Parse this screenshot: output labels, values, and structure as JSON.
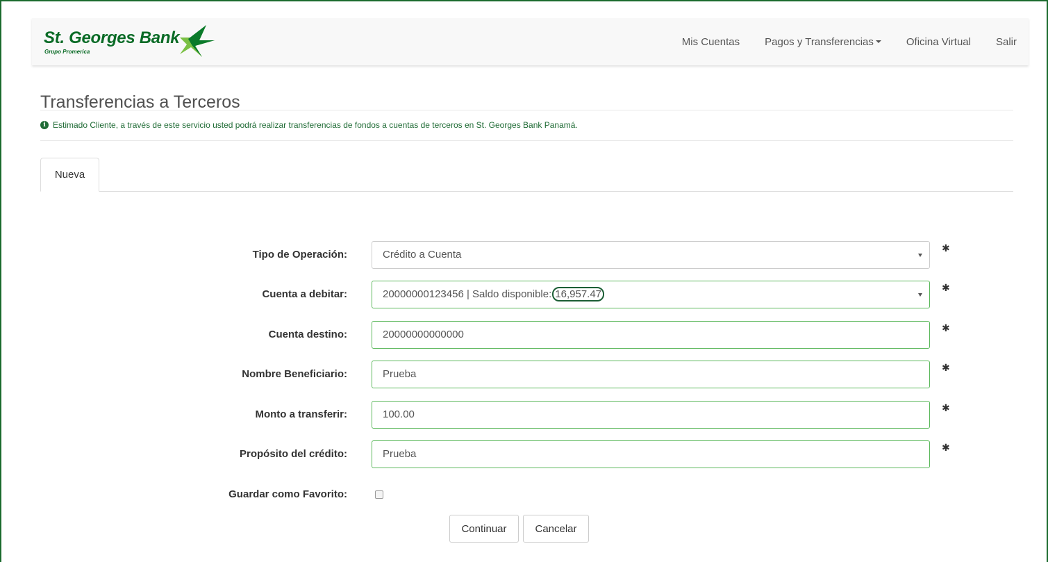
{
  "brand": {
    "name": "St. Georges Bank",
    "subtitle": "Grupo Promerica",
    "star_color": "#0a8a2a"
  },
  "nav": {
    "items": [
      "Mis Cuentas",
      "Pagos y Transferencias",
      "Oficina Virtual",
      "Salir"
    ]
  },
  "page": {
    "title": "Transferencias a Terceros",
    "info": "Estimado Cliente, a través de este servicio usted podrá realizar transferencias de fondos a cuentas de terceros en St. Georges Bank Panamá."
  },
  "tabs": [
    "Nueva"
  ],
  "form": {
    "tipo_operacion": {
      "label": "Tipo de Operación:",
      "value": "Crédito a Cuenta"
    },
    "cuenta_debitar": {
      "label": "Cuenta a debitar:",
      "value": "20000000123456 | Saldo disponible:",
      "saldo": "16,957.47"
    },
    "cuenta_destino": {
      "label": "Cuenta destino:",
      "value": "20000000000000"
    },
    "nombre_beneficiario": {
      "label": "Nombre Beneficiario:",
      "value": "Prueba"
    },
    "monto": {
      "label": "Monto a transferir:",
      "value": "100.00"
    },
    "proposito": {
      "label": "Propósito del crédito:",
      "value": "Prueba"
    },
    "favorito": {
      "label": "Guardar como Favorito:",
      "checked": false
    },
    "required_mark": "✱"
  },
  "buttons": {
    "continuar": "Continuar",
    "cancelar": "Cancelar"
  },
  "colors": {
    "brand_green": "#0a6b26",
    "valid_border": "#5cb85c",
    "frame": "#1b6b2e"
  }
}
